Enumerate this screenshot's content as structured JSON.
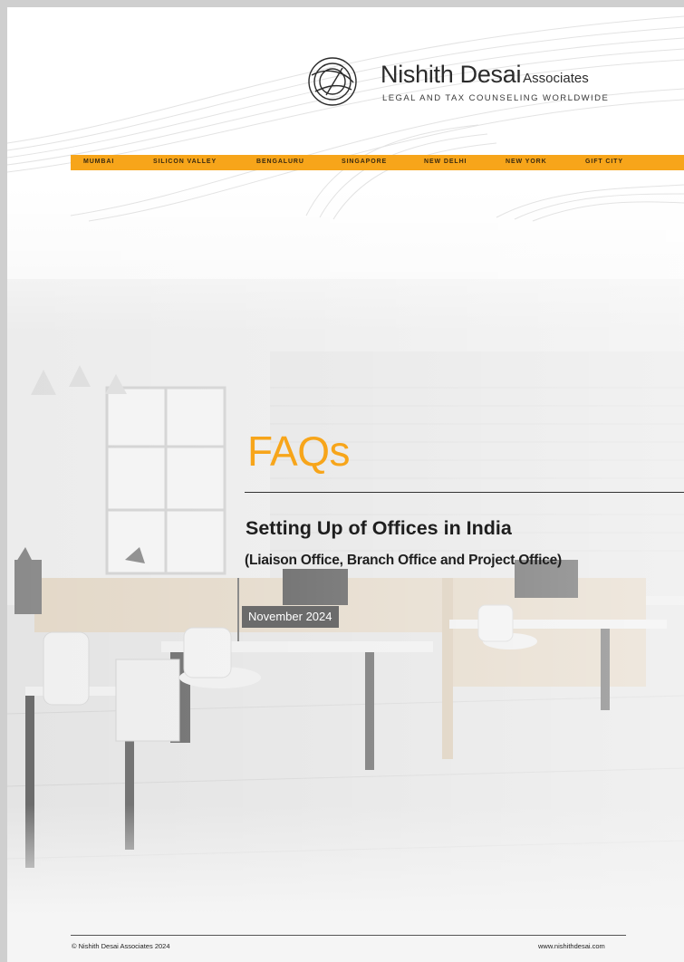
{
  "brand": {
    "name": "Nishith Desai",
    "suffix": "Associates",
    "tagline": "LEGAL AND TAX COUNSELING WORLDWIDE",
    "accent_color": "#f7a51a"
  },
  "cities": [
    "MUMBAI",
    "SILICON VALLEY",
    "BENGALURU",
    "SINGAPORE",
    "NEW DELHI",
    "NEW YORK",
    "GIFT CITY"
  ],
  "cover": {
    "heading": "FAQs",
    "title": "Setting Up of Offices in India",
    "subtitle": "(Liaison Office, Branch Office and Project Office)",
    "date": "November 2024"
  },
  "footer": {
    "copyright": "© Nishith Desai Associates 2024",
    "website": "www.nishithdesai.com"
  },
  "icons": {
    "logo": "circular-swirl-logo-icon"
  }
}
